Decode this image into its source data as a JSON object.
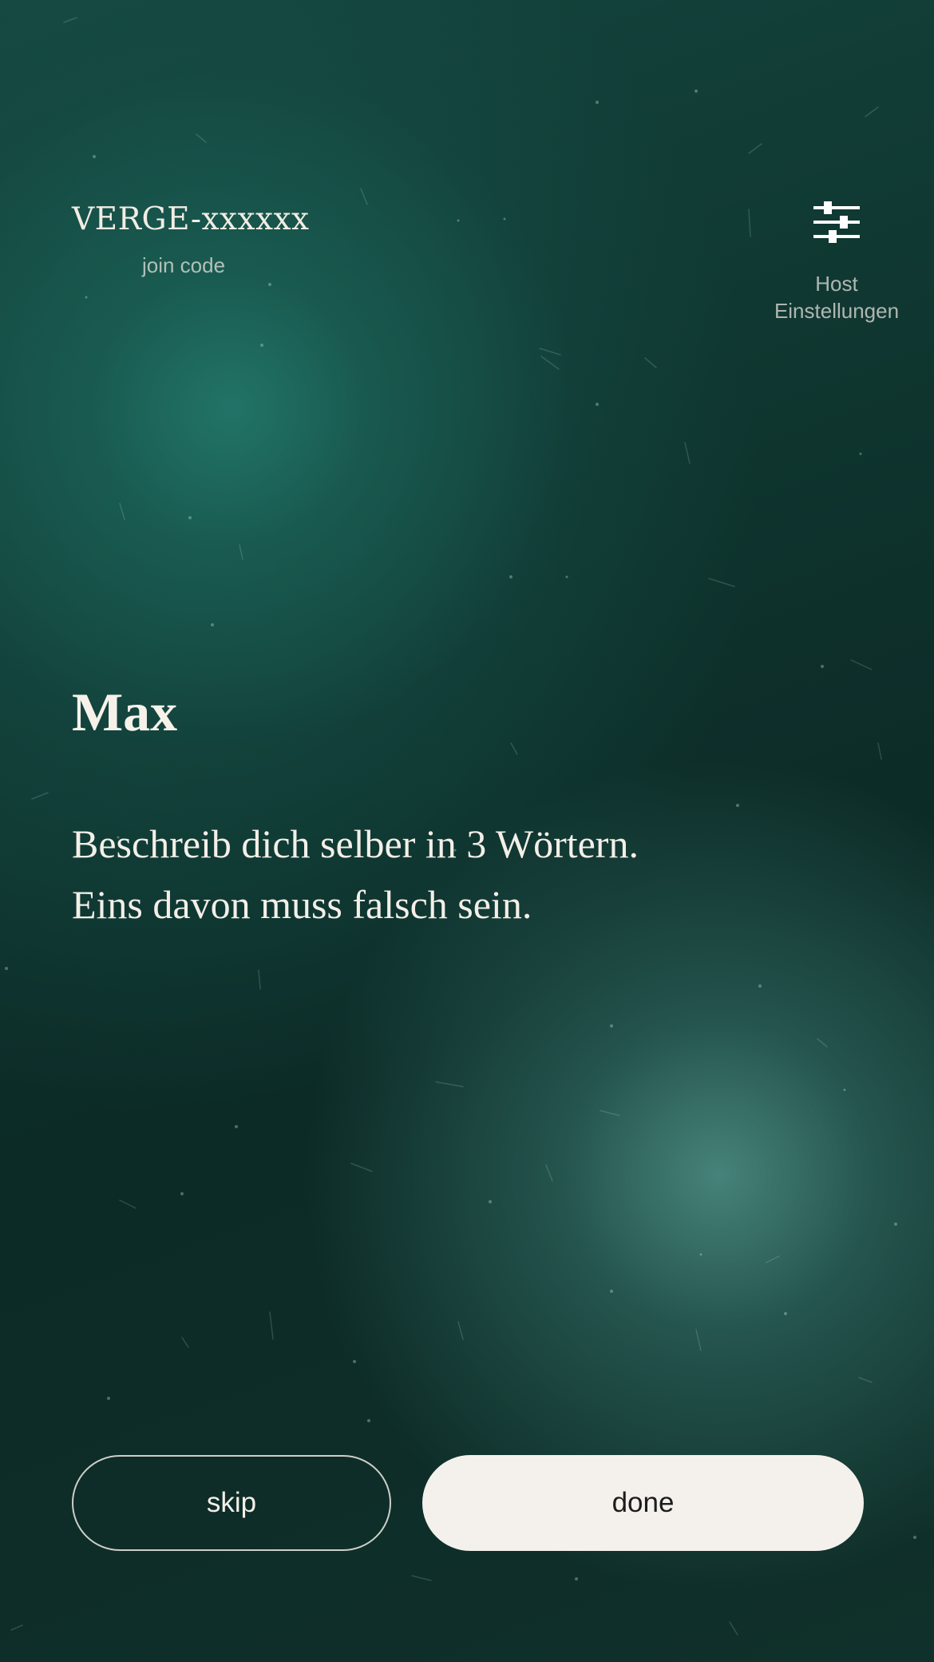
{
  "header": {
    "join_code": "VERGE-xxxxxx",
    "join_code_label": "join code",
    "host_settings_icon": "sliders-icon",
    "host_settings_label": "Host Einstellungen"
  },
  "main": {
    "player_name": "Max",
    "prompt_lines": [
      "Beschreib dich selber in 3 Wörtern.",
      "Eins davon muss falsch sein."
    ]
  },
  "actions": {
    "skip_label": "skip",
    "done_label": "done"
  },
  "colors": {
    "background_dark": "#0d2824",
    "background_accent": "#1f7a6c",
    "text": "#f3efe8",
    "done_button": "#f4f1ec"
  }
}
